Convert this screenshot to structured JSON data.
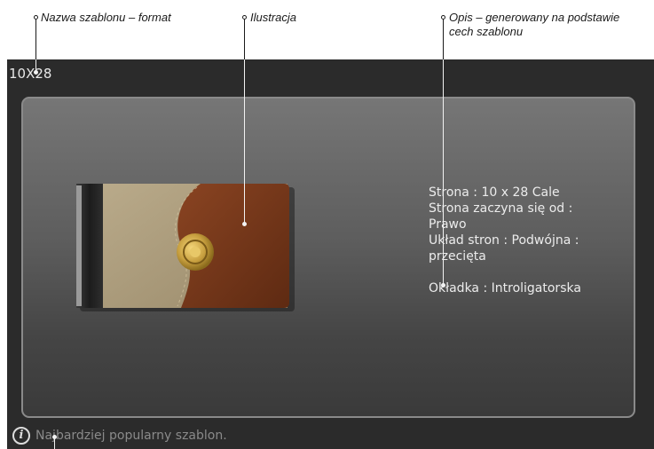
{
  "callouts": {
    "template_name_format": "Nazwa szablonu – format",
    "illustration": "Ilustracja",
    "description_line1": "Opis – generowany na podstawie",
    "description_line2": "cech szablonu"
  },
  "template": {
    "name": "10X28",
    "details": {
      "page": "Strona : 10 x 28 Cale",
      "starts_from_label": "Strona zaczyna się od :",
      "starts_from_value": "Prawo",
      "layout_label": "Układ stron : Podwójna :",
      "layout_value": "przecięta",
      "cover": "Okładka : Introligatorska"
    },
    "hint": "Najbardziej popularny szablon.",
    "info_icon": "info-icon"
  },
  "colors": {
    "panel_bg": "#2b2b2b",
    "card_border": "#8a8a8a",
    "leather_light": "#a89878",
    "leather_dark": "#7a3a1c",
    "clasp": "#c8a040"
  }
}
